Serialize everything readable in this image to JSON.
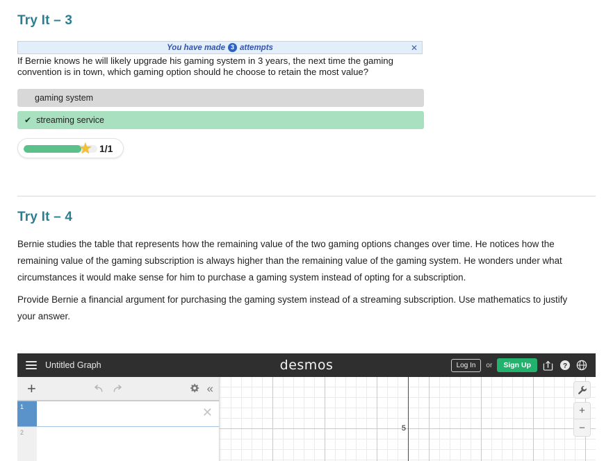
{
  "try3": {
    "heading": "Try It – 3",
    "banner": {
      "prefix": "You have made",
      "count": "3",
      "suffix": "attempts",
      "close_label": "✕"
    },
    "question": "If Bernie knows he will likely upgrade his gaming system in 3 years, the next time the gaming convention is in town, which gaming option should he choose to retain the most value?",
    "options": [
      {
        "label": "gaming system",
        "state": "neutral",
        "check": ""
      },
      {
        "label": "streaming service",
        "state": "correct",
        "check": "✔"
      }
    ],
    "score": {
      "value": "1/1",
      "fill_percent": 78,
      "star": "★",
      "bar_color": "#5cc08a",
      "star_color": "#f5c133"
    }
  },
  "try4": {
    "heading": "Try It – 4",
    "paragraphs": [
      "Bernie studies the table that represents how the remaining value of the two gaming options changes over time. He notices how the remaining value of the gaming subscription is always higher than the remaining value of the gaming system. He wonders under what circumstances it would make sense for him to purchase a gaming system instead of opting for a subscription.",
      "Provide Bernie a financial argument for purchasing the gaming system instead of a streaming subscription. Use mathematics to justify your answer."
    ]
  },
  "desmos": {
    "graph_title": "Untitled Graph",
    "logo": "desmos",
    "login_label": "Log In",
    "or_label": "or",
    "signup_label": "Sign Up",
    "signup_color": "#23b26d",
    "header_color": "#2f2f2f",
    "icons": {
      "menu": "hamburger-icon",
      "share": "share-icon",
      "help": "help-icon",
      "language": "globe-icon"
    },
    "expressions": {
      "add_label": "+",
      "undo_label": "undo-icon",
      "redo_label": "redo-icon",
      "settings_label": "gear-icon",
      "collapse_label": "«",
      "rows": [
        {
          "index": "1",
          "value": "",
          "selected": true,
          "delete_label": "✕"
        },
        {
          "index": "2",
          "value": "",
          "selected": false,
          "delete_label": ""
        }
      ]
    },
    "graph": {
      "y_tick_label": "5",
      "zoom_in_label": "+",
      "zoom_out_label": "−",
      "tools_label": "wrench-icon"
    }
  }
}
